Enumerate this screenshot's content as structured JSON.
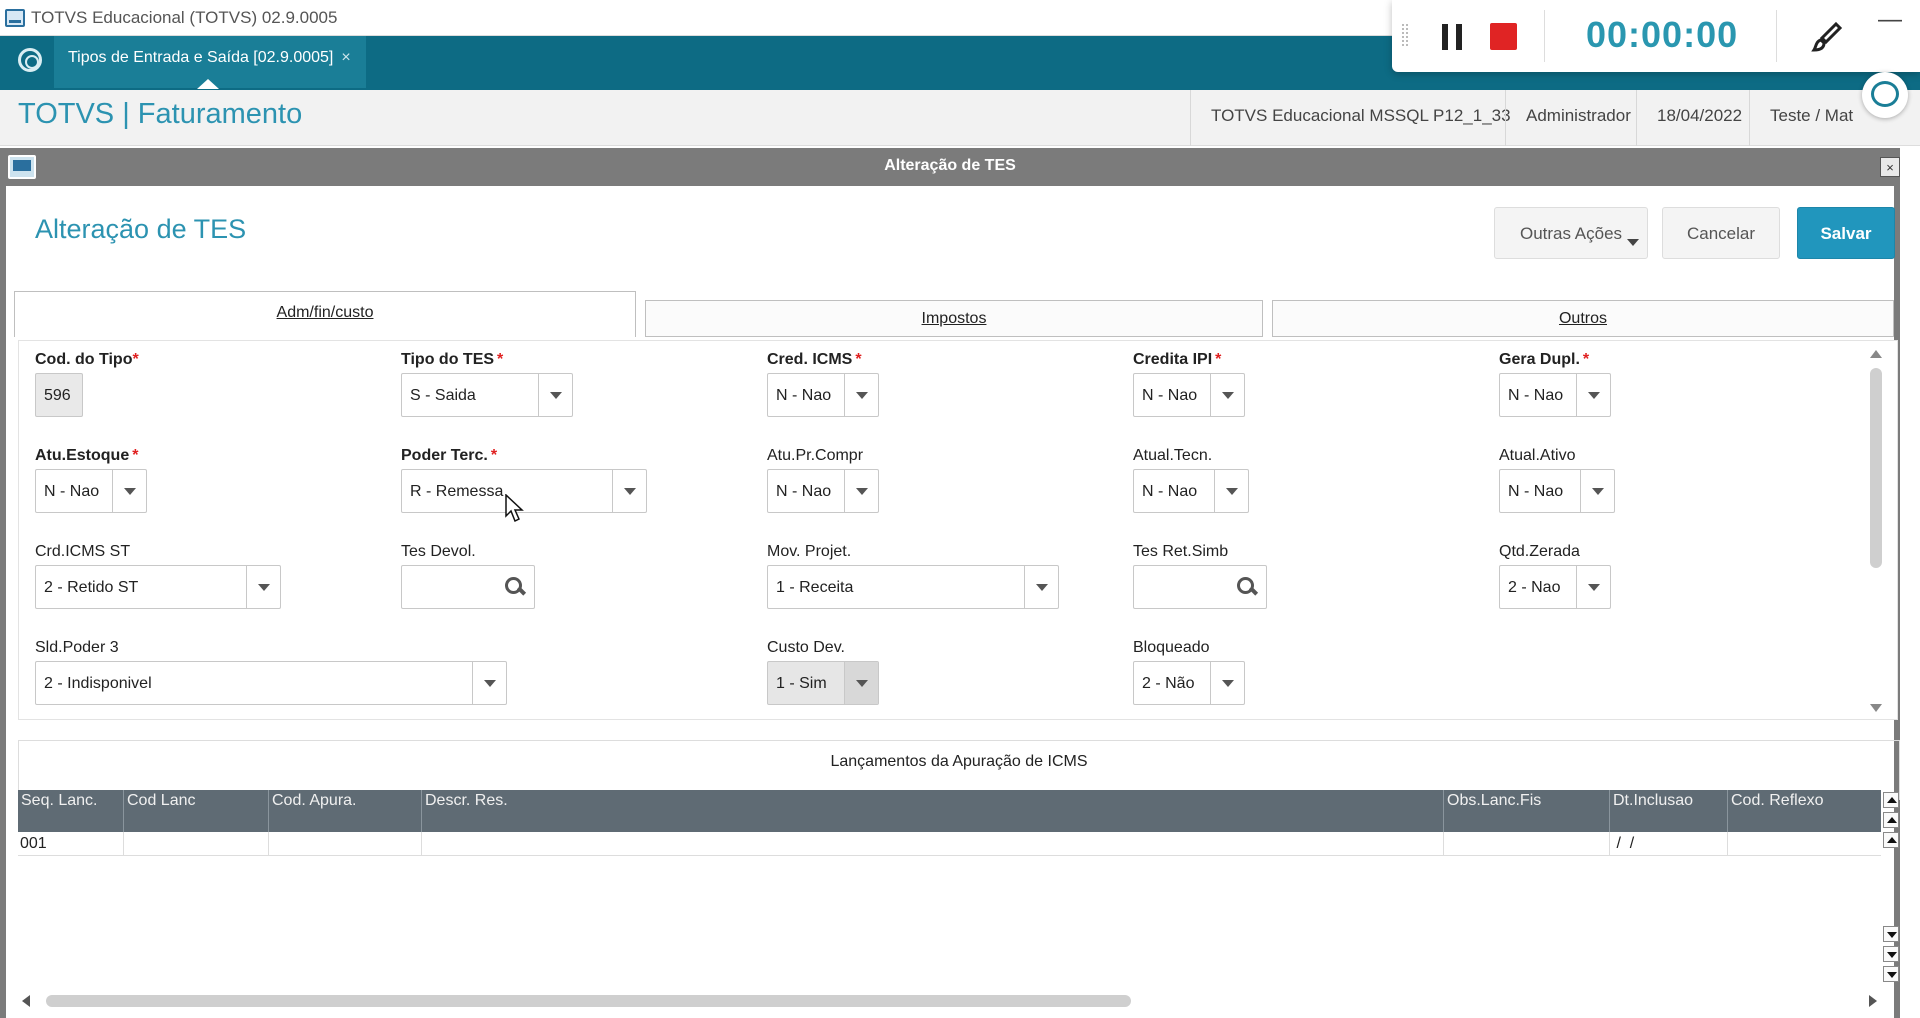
{
  "window": {
    "title": "TOTVS Educacional (TOTVS) 02.9.0005"
  },
  "tabbar": {
    "tab_label": "Tipos de Entrada e Saída [02.9.0005]",
    "close_glyph": "×"
  },
  "recorder": {
    "time": "00:00:00",
    "minimize_glyph": "—"
  },
  "header": {
    "brand": "TOTVS | Faturamento",
    "environment": "TOTVS Educacional MSSQL P12_1_33",
    "user": "Administrador",
    "date": "18/04/2022",
    "company": "Teste / Mat"
  },
  "dialog": {
    "bar_title": "Alteração de TES",
    "close_glyph": "×",
    "title": "Alteração de TES",
    "buttons": {
      "other": "Outras Ações",
      "cancel": "Cancelar",
      "save": "Salvar"
    },
    "tabs": [
      "Adm/fin/custo",
      "Impostos",
      "Outros"
    ]
  },
  "form": {
    "required_mark": "*",
    "cod_tipo": {
      "label": "Cod. do Tipo",
      "value": "596"
    },
    "tipo_tes": {
      "label": "Tipo do TES",
      "value": "S - Saida"
    },
    "cred_icms": {
      "label": "Cred. ICMS",
      "value": "N - Nao"
    },
    "credita_ipi": {
      "label": "Credita IPI",
      "value": "N - Nao"
    },
    "gera_dupl": {
      "label": "Gera Dupl.",
      "value": "N - Nao"
    },
    "atu_estoque": {
      "label": "Atu.Estoque",
      "value": "N - Nao"
    },
    "poder_terc": {
      "label": "Poder Terc.",
      "value": "R - Remessa"
    },
    "atu_pr_compr": {
      "label": "Atu.Pr.Compr",
      "value": "N - Nao"
    },
    "atual_tecn": {
      "label": "Atual.Tecn.",
      "value": "N - Nao"
    },
    "atual_ativo": {
      "label": "Atual.Ativo",
      "value": "N - Nao"
    },
    "crd_icms_st": {
      "label": "Crd.ICMS ST",
      "value": "2 - Retido ST"
    },
    "tes_devol": {
      "label": "Tes Devol.",
      "value": ""
    },
    "mov_projet": {
      "label": "Mov. Projet.",
      "value": "1 - Receita"
    },
    "tes_ret_simb": {
      "label": "Tes Ret.Simb",
      "value": ""
    },
    "qtd_zerada": {
      "label": "Qtd.Zerada",
      "value": "2 - Nao"
    },
    "sld_poder3": {
      "label": "Sld.Poder 3",
      "value": "2 - Indisponivel"
    },
    "custo_dev": {
      "label": "Custo Dev.",
      "value": "1 - Sim"
    },
    "bloqueado": {
      "label": "Bloqueado",
      "value": "2 - Não"
    }
  },
  "grid": {
    "title": "Lançamentos da Apuração de ICMS",
    "columns": [
      "Seq. Lanc.",
      "Cod Lanc",
      "Cod. Apura.",
      "Descr. Res.",
      "Obs.Lanc.Fis",
      "Dt.Inclusao",
      "Cod. Reflexo"
    ],
    "rows": [
      [
        "001",
        "",
        "",
        "",
        "",
        " /  /",
        ""
      ]
    ]
  },
  "colors": {
    "teal": "#0d6b84",
    "accent": "#2c93b1",
    "save": "#2196bd",
    "required": "#e02020"
  }
}
